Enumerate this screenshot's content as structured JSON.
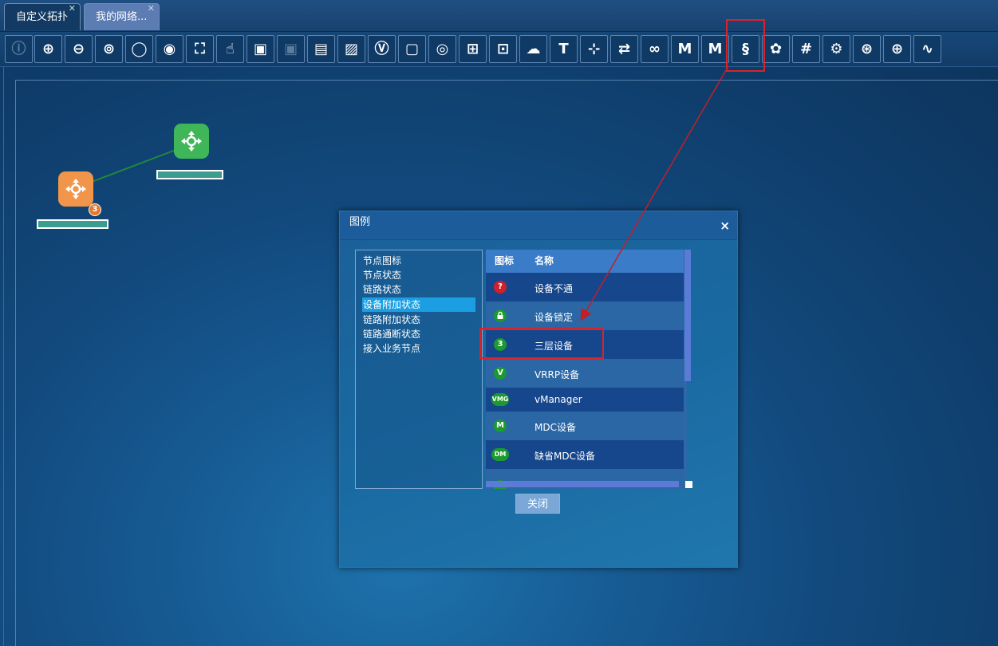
{
  "tabs": [
    {
      "label": "自定义拓扑"
    },
    {
      "label": "我的网络..."
    }
  ],
  "toolbar": {
    "buttons": [
      {
        "icon": "info-icon",
        "glyph": "ⓘ",
        "disabled": true
      },
      {
        "icon": "zoom-in-icon",
        "glyph": "⊕"
      },
      {
        "icon": "zoom-out-icon",
        "glyph": "⊖"
      },
      {
        "icon": "fit-icon",
        "glyph": "⊚"
      },
      {
        "icon": "circle-icon",
        "glyph": "◯"
      },
      {
        "icon": "eye-icon",
        "glyph": "◉"
      },
      {
        "icon": "fullscreen-icon",
        "glyph": "⛶"
      },
      {
        "icon": "hand-icon",
        "glyph": "☝"
      },
      {
        "icon": "add-image-icon",
        "glyph": "▣"
      },
      {
        "icon": "remove-image-icon",
        "glyph": "▣",
        "disabled": true
      },
      {
        "icon": "save-icon",
        "glyph": "▤"
      },
      {
        "icon": "image-icon",
        "glyph": "▨"
      },
      {
        "icon": "v-box-icon",
        "glyph": "Ⓥ"
      },
      {
        "icon": "frame-icon",
        "glyph": "▢"
      },
      {
        "icon": "ring-icon",
        "glyph": "◎"
      },
      {
        "icon": "topology-tree-icon",
        "glyph": "⊞"
      },
      {
        "icon": "add-device-icon",
        "glyph": "⊡"
      },
      {
        "icon": "add-cloud-icon",
        "glyph": "☁"
      },
      {
        "icon": "add-text-icon",
        "glyph": "T"
      },
      {
        "icon": "add-link-icon",
        "glyph": "⊹"
      },
      {
        "icon": "link-edit-icon",
        "glyph": "⇄"
      },
      {
        "icon": "search-binoculars-icon",
        "glyph": "∞"
      },
      {
        "icon": "ms-text-icon",
        "glyph": "Ⅿ"
      },
      {
        "icon": "ms-settings-icon",
        "glyph": "Ⅿ"
      },
      {
        "icon": "legend-icon",
        "glyph": "§"
      },
      {
        "icon": "palette-icon",
        "glyph": "✿"
      },
      {
        "icon": "grid-icon",
        "glyph": "#"
      },
      {
        "icon": "settings-gear-icon",
        "glyph": "⚙"
      },
      {
        "icon": "network-globe-icon",
        "glyph": "⊛"
      },
      {
        "icon": "earth-icon",
        "glyph": "⊕"
      },
      {
        "icon": "monitor-pulse-icon",
        "glyph": "∿"
      }
    ]
  },
  "topology": {
    "badge": "3"
  },
  "legend_dialog": {
    "title": "图例",
    "close_symbol": "×",
    "categories": [
      {
        "label": "节点图标",
        "selected": false
      },
      {
        "label": "节点状态",
        "selected": false
      },
      {
        "label": "链路状态",
        "selected": false
      },
      {
        "label": "设备附加状态",
        "selected": true
      },
      {
        "label": "链路附加状态",
        "selected": false
      },
      {
        "label": "链路通断状态",
        "selected": false
      },
      {
        "label": "接入业务节点",
        "selected": false
      }
    ],
    "table_headers": {
      "icon": "图标",
      "name": "名称"
    },
    "rows": [
      {
        "icon": "?",
        "icon_name": "unreachable-icon",
        "name": "设备不通"
      },
      {
        "icon": "🔒",
        "icon_name": "lock-icon",
        "name": "设备锁定"
      },
      {
        "icon": "3",
        "icon_name": "layer3-icon",
        "name": "三层设备"
      },
      {
        "icon": "V",
        "icon_name": "vrrp-icon",
        "name": "VRRP设备"
      },
      {
        "icon": "VMG",
        "icon_name": "vmanager-icon",
        "name": "vManager"
      },
      {
        "icon": "M",
        "icon_name": "mdc-icon",
        "name": "MDC设备"
      },
      {
        "icon": "DM",
        "icon_name": "default-mdc-icon",
        "name": "缺省MDC设备"
      }
    ],
    "close_button": "关闭"
  },
  "colors": {
    "highlight": "#d9232a",
    "selected_category": "#1b9fe2",
    "node_green": "#3fb657",
    "node_orange": "#f0954a"
  }
}
